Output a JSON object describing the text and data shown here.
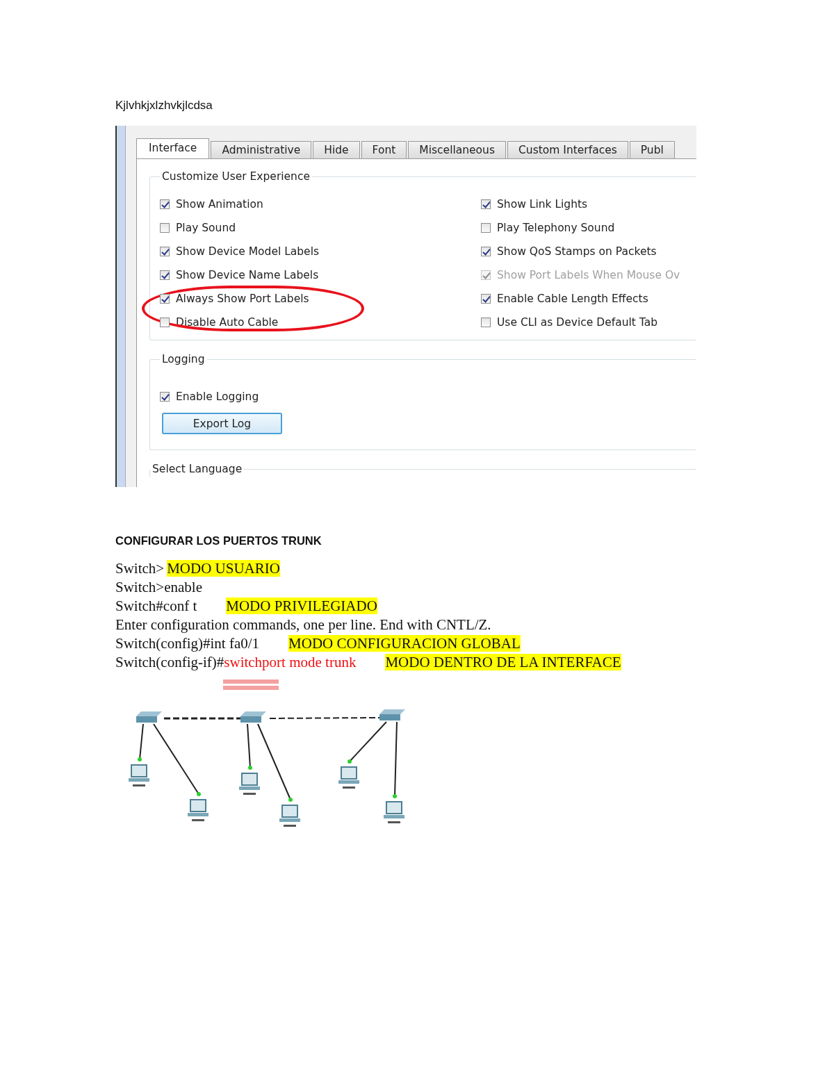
{
  "title": "Kjlvhkjxlzhvkjlcdsa",
  "dialog": {
    "tabs": [
      {
        "label": "Interface",
        "selected": true
      },
      {
        "label": "Administrative",
        "selected": false
      },
      {
        "label": "Hide",
        "selected": false
      },
      {
        "label": "Font",
        "selected": false
      },
      {
        "label": "Miscellaneous",
        "selected": false
      },
      {
        "label": "Custom Interfaces",
        "selected": false
      },
      {
        "label": "Publ",
        "selected": false
      }
    ],
    "experience": {
      "title": "Customize User Experience",
      "left": [
        {
          "label": "Show Animation",
          "checked": true,
          "disabled": false,
          "circled": false
        },
        {
          "label": "Play Sound",
          "checked": false,
          "disabled": false,
          "circled": false
        },
        {
          "label": "Show Device Model Labels",
          "checked": true,
          "disabled": false,
          "circled": false
        },
        {
          "label": "Show Device Name Labels",
          "checked": true,
          "disabled": false,
          "circled": false
        },
        {
          "label": "Always Show Port Labels",
          "checked": true,
          "disabled": false,
          "circled": true
        },
        {
          "label": "Disable Auto Cable",
          "checked": false,
          "disabled": false,
          "circled": true
        }
      ],
      "right": [
        {
          "label": "Show Link Lights",
          "checked": true,
          "disabled": false
        },
        {
          "label": "Play Telephony Sound",
          "checked": false,
          "disabled": false
        },
        {
          "label": "Show QoS Stamps on Packets",
          "checked": true,
          "disabled": false
        },
        {
          "label": "Show Port Labels When Mouse Ov",
          "checked": true,
          "disabled": true
        },
        {
          "label": "Enable Cable Length Effects",
          "checked": true,
          "disabled": false
        },
        {
          "label": "Use CLI as Device Default Tab",
          "checked": false,
          "disabled": false
        }
      ]
    },
    "logging": {
      "title": "Logging",
      "option": {
        "label": "Enable Logging",
        "checked": true
      },
      "button": "Export Log"
    },
    "language": {
      "title": "Select Language"
    }
  },
  "heading": "CONFIGURAR LOS PUERTOS TRUNK",
  "lines": [
    [
      {
        "kind": "plain",
        "text": "Switch>"
      },
      {
        "kind": "mode",
        "text": "MODO USUARIO"
      }
    ],
    [
      {
        "kind": "plain",
        "text": "Switch>enable"
      }
    ],
    [
      {
        "kind": "plain",
        "text": "Switch#conf t"
      },
      {
        "kind": "mode",
        "text": "MODO PRIVILEGIADO"
      }
    ],
    [
      {
        "kind": "plain",
        "text": "Enter configuration commands, one per line. End with CNTL/Z."
      }
    ],
    [
      {
        "kind": "plain",
        "text": "Switch(config)#int fa0/1"
      },
      {
        "kind": "mode",
        "text": "MODO CONFIGURACION GLOBAL"
      }
    ],
    [
      {
        "kind": "plain",
        "text": "Switch(config-if)#"
      },
      {
        "kind": "command",
        "text": "switchport mode trunk"
      },
      {
        "kind": "mode",
        "text": "MODO DENTRO DE LA INTERFACE"
      }
    ]
  ]
}
